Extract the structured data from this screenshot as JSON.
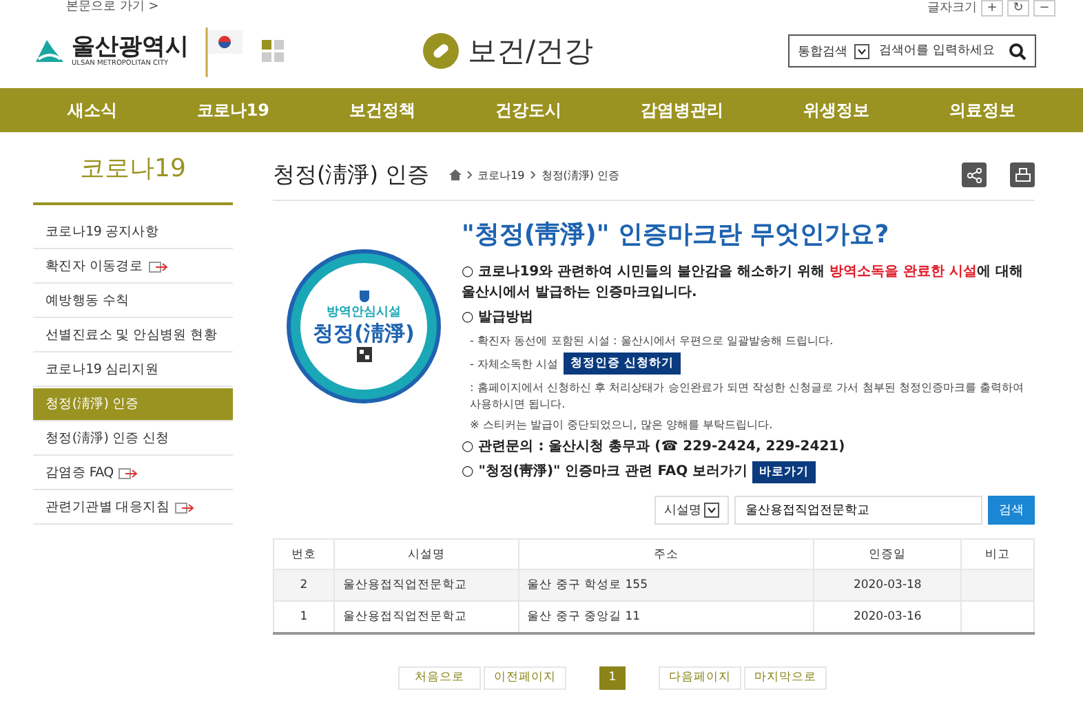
{
  "utility": {
    "skip_link": "본문으로 가기 >",
    "font_size_label": "글자크기",
    "font_buttons": [
      "+",
      "↻",
      "−"
    ]
  },
  "header": {
    "logo_name": "울산광역시",
    "logo_sub": "ULSAN METROPOLITAN CITY",
    "site_title": "보건/건강",
    "search": {
      "scope": "통합검색",
      "placeholder": "검색어를 입력하세요"
    }
  },
  "nav": [
    "새소식",
    "코로나19",
    "보건정책",
    "건강도시",
    "감염병관리",
    "위생정보",
    "의료정보"
  ],
  "sidebar": {
    "title": "코로나19",
    "items": [
      {
        "label": "코로나19 공지사항",
        "selected": false,
        "external": false
      },
      {
        "label": "확진자 이동경로",
        "selected": false,
        "external": true
      },
      {
        "label": "예방행동 수칙",
        "selected": false,
        "external": false
      },
      {
        "label": "선별진료소 및 안심병원 현황",
        "selected": false,
        "external": false
      },
      {
        "label": "코로나19 심리지원",
        "selected": false,
        "external": false
      },
      {
        "label": "청정(淸淨) 인증",
        "selected": true,
        "external": false
      },
      {
        "label": "청정(淸淨) 인증 신청",
        "selected": false,
        "external": false
      },
      {
        "label": "감염증 FAQ",
        "selected": false,
        "external": true
      },
      {
        "label": "관련기관별 대응지침",
        "selected": false,
        "external": true
      }
    ]
  },
  "page": {
    "title": "청정(淸淨) 인증",
    "breadcrumb": [
      "코로나19",
      "청정(淸淨) 인증"
    ]
  },
  "badge": {
    "top": "방역안심시설",
    "main": "청정(淸淨)"
  },
  "info": {
    "heading": "\"청정(靑淨)\" 인증마크란 무엇인가요?",
    "lines": [
      {
        "kind": "bullet",
        "text": "○ 코로나19와 관련하여 시민들의 불안감을 해소하기 위해 ",
        "highlight": "방역소독을 완료한 시설",
        "after": "에 대해 울산시에서 발급하는 인증마크입니다."
      },
      {
        "kind": "bullet",
        "text": "○ 발급방법"
      },
      {
        "kind": "sub",
        "text": "- 확진자 동선에 포함된 시설 : 울산시에서 우편으로 일괄발송해 드립니다."
      },
      {
        "kind": "sub",
        "text": "- 자체소독한 시설",
        "button": "청정인증 신청하기"
      },
      {
        "kind": "sub",
        "text": ": 홈페이지에서 신청하신 후 처리상태가 승인완료가 되면 작성한 신청글로 가서 첨부된 청정인증마크를 출력하여 사용하시면 됩니다."
      },
      {
        "kind": "sub",
        "text": "※ 스티커는 발급이 중단되었으니, 많은 양해를 부탁드립니다."
      },
      {
        "kind": "bullet",
        "text": "○ 관련문의 : 울산시청 총무과 (☎ 229-2424, 229-2421)"
      },
      {
        "kind": "bullet",
        "text": "○ \"청정(靑淨)\" 인증마크 관련 FAQ 보러가기",
        "button": "바로가기"
      }
    ]
  },
  "filter": {
    "field": "시설명",
    "value": "울산용접직업전문학교",
    "button": "검색"
  },
  "table": {
    "columns": [
      "번호",
      "시설명",
      "주소",
      "인증일",
      "비고"
    ],
    "rows": [
      [
        "2",
        "울산용접직업전문학교",
        "울산 중구 학성로 155",
        "2020-03-18",
        ""
      ],
      [
        "1",
        "울산용접직업전문학교",
        "울산 중구 중앙길 11",
        "2020-03-16",
        ""
      ]
    ]
  },
  "pagination": {
    "first": "처음으로",
    "prev": "이전페이지",
    "pages": [
      {
        "label": "1",
        "selected": true
      }
    ],
    "next": "다음페이지",
    "last": "마지막으로"
  }
}
